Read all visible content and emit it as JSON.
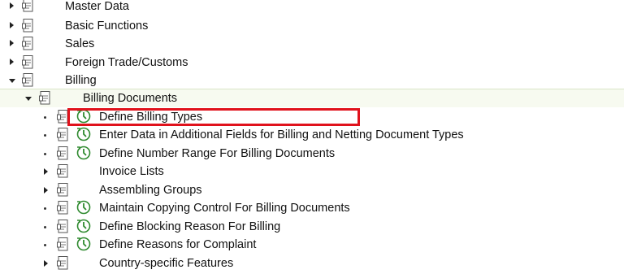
{
  "nodes": [
    {
      "label": "Master Data",
      "expander": "collapsed",
      "exec_icon": false
    },
    {
      "label": "Basic Functions",
      "expander": "collapsed",
      "exec_icon": false
    },
    {
      "label": "Sales",
      "expander": "collapsed",
      "exec_icon": false
    },
    {
      "label": "Foreign Trade/Customs",
      "expander": "collapsed",
      "exec_icon": false
    },
    {
      "label": "Billing",
      "expander": "expanded",
      "exec_icon": false
    },
    {
      "label": "Billing Documents",
      "expander": "expanded",
      "exec_icon": false
    },
    {
      "label": "Define Billing Types",
      "expander": "leaf",
      "exec_icon": true
    },
    {
      "label": "Enter Data in Additional Fields for Billing and Netting Document Types",
      "expander": "leaf",
      "exec_icon": true
    },
    {
      "label": "Define Number Range For Billing Documents",
      "expander": "leaf",
      "exec_icon": true
    },
    {
      "label": "Invoice Lists",
      "expander": "collapsed",
      "exec_icon": false
    },
    {
      "label": "Assembling Groups",
      "expander": "collapsed",
      "exec_icon": false
    },
    {
      "label": "Maintain Copying Control For Billing Documents",
      "expander": "leaf",
      "exec_icon": true
    },
    {
      "label": "Define Blocking Reason For Billing",
      "expander": "leaf",
      "exec_icon": true
    },
    {
      "label": "Define Reasons for Complaint",
      "expander": "leaf",
      "exec_icon": true
    },
    {
      "label": "Country-specific Features",
      "expander": "collapsed",
      "exec_icon": false
    }
  ],
  "highlighted_node": "Define Billing Types",
  "colors": {
    "highlight_border": "#e0121c",
    "exec_icon": "#2f8a2f",
    "selected_row_bg": "#f7faf0"
  },
  "icons": {
    "folder": "document-node-icon",
    "activity": "execute-clock-icon"
  }
}
